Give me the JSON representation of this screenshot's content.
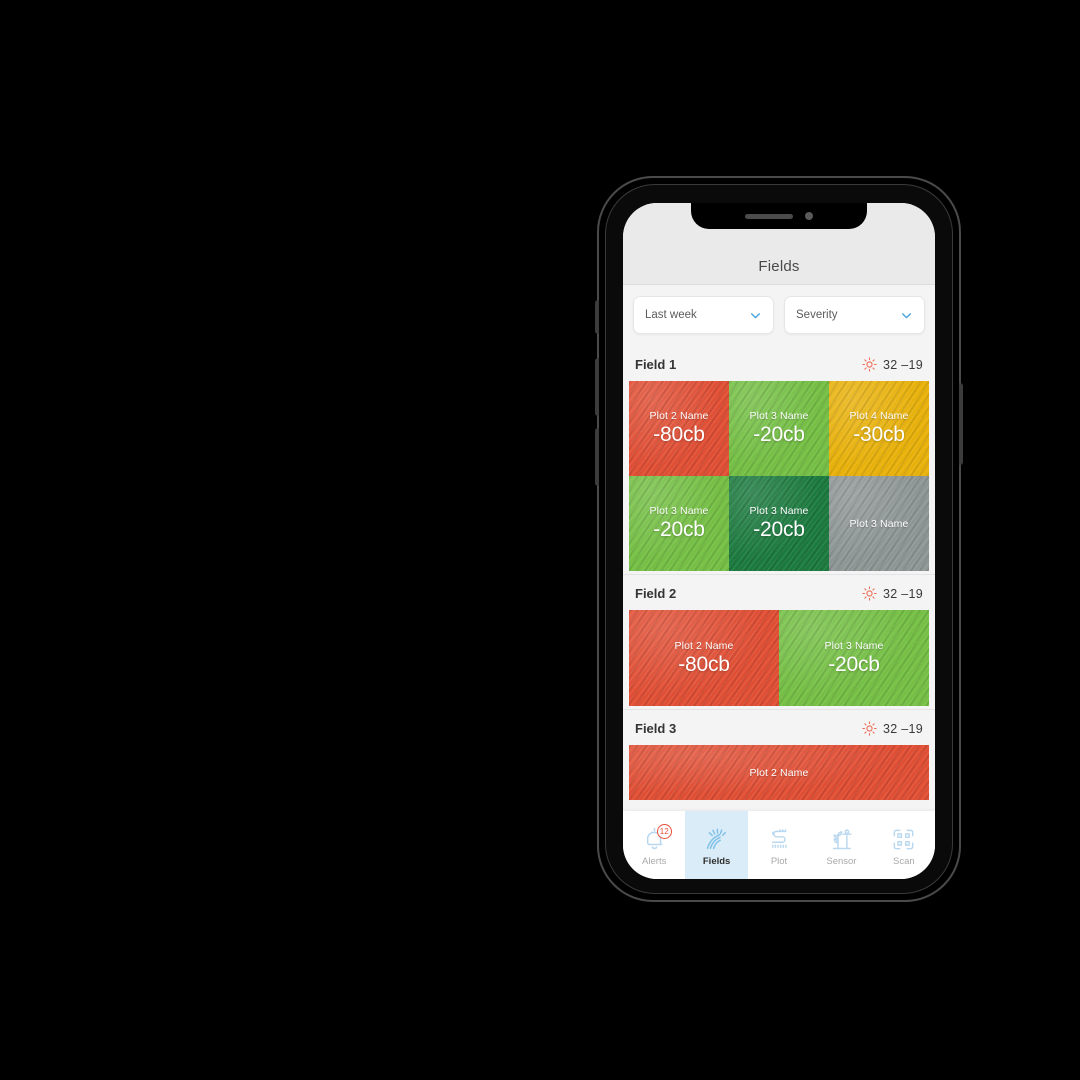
{
  "app": {
    "title": "Fields"
  },
  "filters": [
    {
      "name": "date-range",
      "label": "Last week",
      "icon": "chevron-down-icon"
    },
    {
      "name": "severity",
      "label": "Severity",
      "icon": "chevron-down-icon"
    }
  ],
  "colors": {
    "critical_red": "#e04e34",
    "light_green": "#74bf44",
    "amber": "#e8b10a",
    "dark_green": "#1b7a3e",
    "gray_inactive": "#8e9695",
    "accent_blue": "#4aa3e0",
    "active_tab_bg": "#d9ecf7",
    "badge_red": "#e8503a",
    "sun_icon": "#ef6a52"
  },
  "fields": [
    {
      "name": "Field 1",
      "weather": {
        "icon": "sun-icon",
        "temp": "32 –19"
      },
      "columns": 3,
      "plots": [
        {
          "label": "Plot 2 Name",
          "value": "-80cb",
          "color": "#e04e34"
        },
        {
          "label": "Plot 3 Name",
          "value": "-20cb",
          "color": "#74bf44"
        },
        {
          "label": "Plot 4 Name",
          "value": "-30cb",
          "color": "#e8b10a"
        },
        {
          "label": "Plot 3 Name",
          "value": "-20cb",
          "color": "#74bf44"
        },
        {
          "label": "Plot 3 Name",
          "value": "-20cb",
          "color": "#1b7a3e"
        },
        {
          "label": "Plot 3 Name",
          "value": "",
          "color": "#8e9695"
        }
      ]
    },
    {
      "name": "Field 2",
      "weather": {
        "icon": "sun-icon",
        "temp": "32 –19"
      },
      "columns": 2,
      "plots": [
        {
          "label": "Plot 2 Name",
          "value": "-80cb",
          "color": "#e04e34"
        },
        {
          "label": "Plot 3 Name",
          "value": "-20cb",
          "color": "#74bf44"
        }
      ]
    },
    {
      "name": "Field 3",
      "weather": {
        "icon": "sun-icon",
        "temp": "32 –19"
      },
      "columns": 1,
      "plots": [
        {
          "label": "Plot 2 Name",
          "value": "",
          "color": "#e04e34"
        }
      ]
    }
  ],
  "tabs": [
    {
      "label": "Alerts",
      "icon": "bell-icon",
      "active": false,
      "badge": "12"
    },
    {
      "label": "Fields",
      "icon": "wheat-sprout-icon",
      "active": true,
      "badge": ""
    },
    {
      "label": "Plot",
      "icon": "field-rows-icon",
      "active": false,
      "badge": ""
    },
    {
      "label": "Sensor",
      "icon": "plant-sensor-icon",
      "active": false,
      "badge": ""
    },
    {
      "label": "Scan",
      "icon": "qr-scan-icon",
      "active": false,
      "badge": ""
    }
  ]
}
